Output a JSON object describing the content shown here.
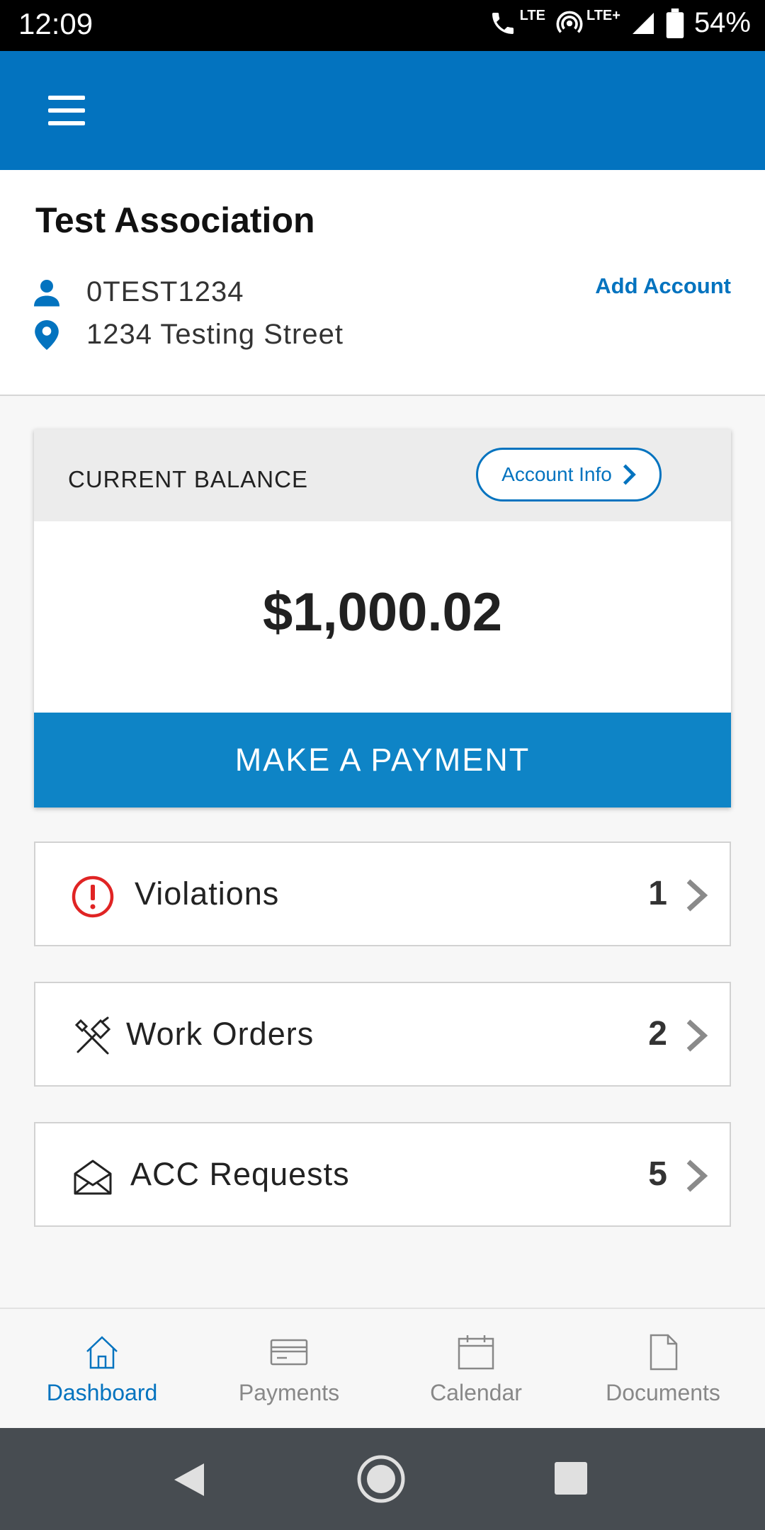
{
  "status_bar": {
    "time": "12:09",
    "call_tag": "LTE",
    "network_tag": "LTE+",
    "battery": "54%"
  },
  "header": {
    "association": "Test Association",
    "account_number": "0TEST1234",
    "address": "1234 Testing Street",
    "add_account": "Add Account"
  },
  "balance_card": {
    "label": "CURRENT BALANCE",
    "account_info": "Account Info",
    "amount": "$1,000.02",
    "pay_button": "MAKE A PAYMENT"
  },
  "list": [
    {
      "label": "Violations",
      "count": "1",
      "icon": "alert-circle-icon"
    },
    {
      "label": "Work Orders",
      "count": "2",
      "icon": "tools-icon"
    },
    {
      "label": "ACC Requests",
      "count": "5",
      "icon": "envelope-icon"
    }
  ],
  "bottom_nav": [
    {
      "label": "Dashboard",
      "icon": "home-icon",
      "active": true
    },
    {
      "label": "Payments",
      "icon": "credit-card-icon",
      "active": false
    },
    {
      "label": "Calendar",
      "icon": "calendar-icon",
      "active": false
    },
    {
      "label": "Documents",
      "icon": "document-icon",
      "active": false
    }
  ],
  "colors": {
    "primary": "#0373bf",
    "pay_button": "#0e84c6",
    "alert": "#e02424",
    "system_nav": "#474c51"
  }
}
